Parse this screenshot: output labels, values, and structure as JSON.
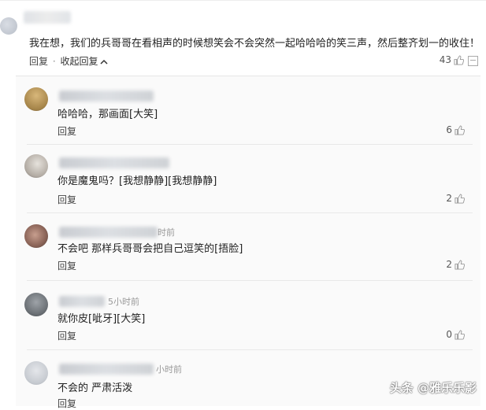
{
  "main": {
    "comment_text": "我在想，我们的兵哥哥在看相声的时候想笑会不会突然一起哈哈哈的笑三声，然后整齐划一的收住！",
    "reply_label": "回复",
    "separator": "·",
    "collapse_label": "收起回复",
    "likes": "43"
  },
  "replies": [
    {
      "time": "",
      "text": "哈哈哈，那画面[大笑]",
      "reply_label": "回复",
      "likes": "6"
    },
    {
      "time": "",
      "text": "你是魔鬼吗？[我想静静][我想静静]",
      "reply_label": "回复",
      "likes": "2"
    },
    {
      "time": "时前",
      "text": "不会吧 那样兵哥哥会把自己逗笑的[捂脸]",
      "reply_label": "回复",
      "likes": "2"
    },
    {
      "time": "5小时前",
      "text": "就你皮[呲牙][大笑]",
      "reply_label": "回复",
      "likes": "0"
    },
    {
      "time": "小时前",
      "text": "不会的 严肃活泼",
      "reply_label": "回复",
      "likes": ""
    }
  ],
  "watermark": "头条 @雅乐乐影",
  "colors": {
    "background": "#ffffff",
    "reply_panel": "#fafafa",
    "text": "#222222",
    "muted": "#999999"
  }
}
